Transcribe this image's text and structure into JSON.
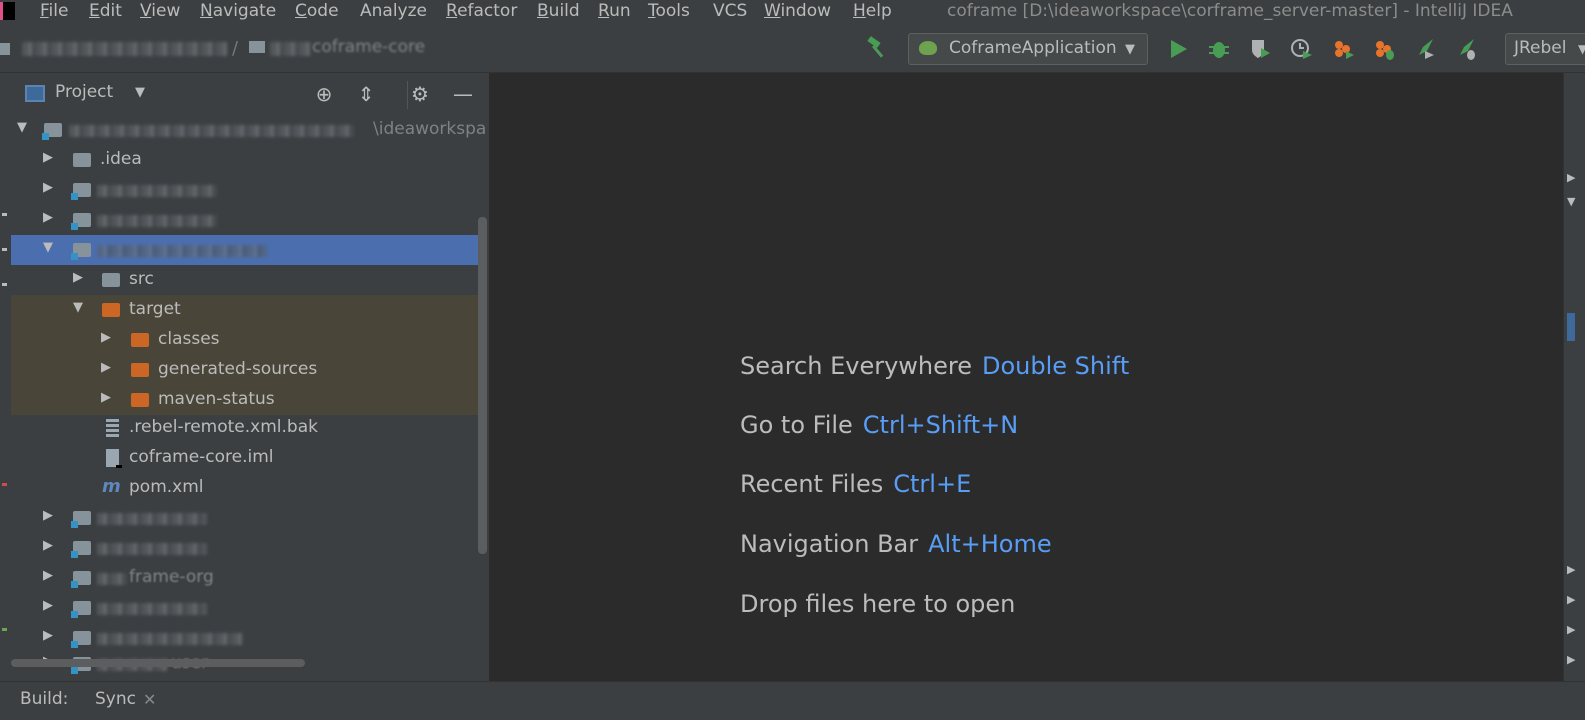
{
  "menu": {
    "items": [
      "File",
      "Edit",
      "View",
      "Navigate",
      "Code",
      "Analyze",
      "Refactor",
      "Build",
      "Run",
      "Tools",
      "VCS",
      "Window",
      "Help"
    ],
    "mnemonics": [
      "F",
      "E",
      "V",
      "N",
      "C",
      "",
      "R",
      "B",
      "R",
      "T",
      "",
      "W",
      "H"
    ]
  },
  "window_title": "coframe [D:\\ideaworkspace\\corframe_server-master] - IntelliJ IDEA",
  "toolbar": {
    "breadcrumb_module": "coframe-core",
    "run_config": "CoframeApplication",
    "jrebel": "JRebel"
  },
  "project_panel": {
    "title": "Project",
    "root_path_fragment": "\\ideaworkspa",
    "items": {
      "idea": ".idea",
      "src": "src",
      "target": "target",
      "classes": "classes",
      "generated_sources": "generated-sources",
      "maven_status": "maven-status",
      "rebel_bak": ".rebel-remote.xml.bak",
      "core_iml": "coframe-core.iml",
      "pom": "pom.xml",
      "org_fragment": "frame-org",
      "user_fragment": "user"
    }
  },
  "welcome": {
    "hints": [
      {
        "action": "Search Everywhere",
        "shortcut": "Double Shift"
      },
      {
        "action": "Go to File",
        "shortcut": "Ctrl+Shift+N"
      },
      {
        "action": "Recent Files",
        "shortcut": "Ctrl+E"
      },
      {
        "action": "Navigation Bar",
        "shortcut": "Alt+Home"
      },
      {
        "action": "Drop files here to open",
        "shortcut": ""
      }
    ]
  },
  "bottom": {
    "build_label": "Build:",
    "sync_tab": "Sync"
  },
  "colors": {
    "accent_link": "#589df6",
    "selection": "#4b6eaf",
    "excluded_folder": "#cc6625",
    "run_green": "#499c54"
  }
}
